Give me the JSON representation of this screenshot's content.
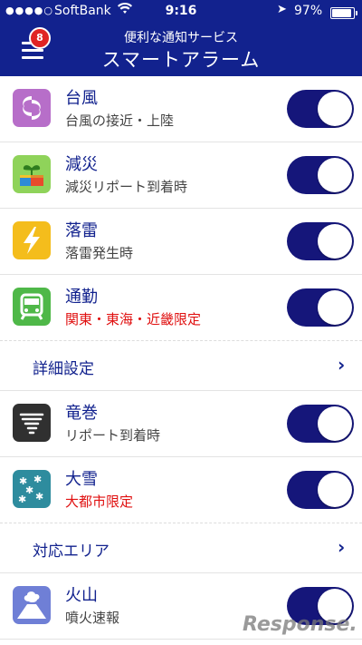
{
  "status": {
    "signal": "●●●●○",
    "carrier": "SoftBank",
    "time": "9:16",
    "battery": "97%"
  },
  "header": {
    "badge_count": "8",
    "subtitle": "便利な通知サービス",
    "title": "スマートアラーム"
  },
  "items": [
    {
      "title": "台風",
      "desc": "台風の接近・上陸",
      "icon": "typhoon-icon",
      "on": true
    },
    {
      "title": "減災",
      "desc": "減災リポート到着時",
      "icon": "disaster-reduction-icon",
      "on": true
    },
    {
      "title": "落雷",
      "desc": "落雷発生時",
      "icon": "lightning-icon",
      "on": true
    },
    {
      "title": "通勤",
      "desc": "関東・東海・近畿限定",
      "icon": "train-icon",
      "on": true
    },
    {
      "title": "竜巻",
      "desc": "リポート到着時",
      "icon": "tornado-icon",
      "on": true
    },
    {
      "title": "大雪",
      "desc": "大都市限定",
      "icon": "snow-icon",
      "on": true
    },
    {
      "title": "火山",
      "desc": "噴火速報",
      "icon": "volcano-icon",
      "on": true
    }
  ],
  "links": {
    "details": "詳細設定",
    "area": "対応エリア"
  },
  "watermark": "Response."
}
